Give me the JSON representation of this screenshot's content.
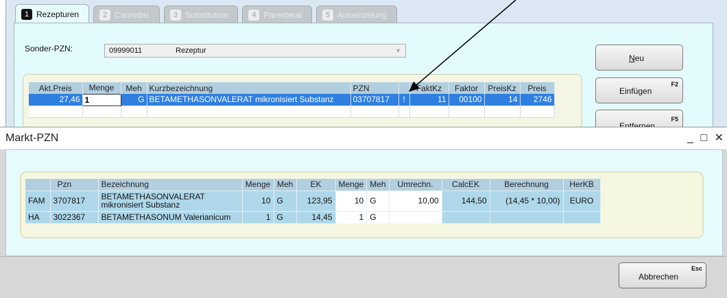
{
  "tabs": [
    {
      "num": "1",
      "label": "Rezepturen"
    },
    {
      "num": "2",
      "label": "Cannabis"
    },
    {
      "num": "3",
      "label": "Substitution"
    },
    {
      "num": "4",
      "label": "Parenteral"
    },
    {
      "num": "5",
      "label": "Auseinzelung"
    }
  ],
  "sonder": {
    "label": "Sonder-PZN:",
    "pzn": "09999011",
    "text": "Rezeptur"
  },
  "upper_grid": {
    "headers": [
      "Akt.Preis",
      "Menge",
      "Meh",
      "Kurzbezeichnung",
      "PZN",
      "",
      "FaktKz",
      "Faktor",
      "PreisKz",
      "Preis"
    ],
    "row": [
      "27,46",
      "1",
      "G",
      "BETAMETHASONVALERAT mikronisiert Substanz",
      "03707817",
      "!",
      "11",
      "00100",
      "14",
      "2746"
    ]
  },
  "buttons": {
    "neu": {
      "underline": "N",
      "rest": "eu"
    },
    "einfuegen": {
      "label": "Einfügen",
      "key": "F2"
    },
    "entfernen": {
      "label": "Entfernen",
      "key": "F5"
    }
  },
  "popup": {
    "title": "Markt-PZN",
    "controls": "_ □ ✕",
    "headers": [
      "",
      "Pzn",
      "Bezeichnung",
      "Menge",
      "Meh",
      "EK",
      "Menge",
      "Meh",
      "Umrechn.",
      "CalcEK",
      "Berechnung",
      "HerKB"
    ],
    "rows": [
      {
        "typ": "FAM",
        "pzn": "3707817",
        "bez": "BETAMETHASONVALERAT mikronisiert Substanz",
        "menge": "10",
        "meh": "G",
        "ek": "123,95",
        "menge2": "10",
        "meh2": "G",
        "umrechn": "10,00",
        "calcek": "144,50",
        "berechnung": "(14,45 * 10,00)",
        "herkb": "EURO"
      },
      {
        "typ": "HA",
        "pzn": "3022367",
        "bez": "BETAMETHASONUM Valerianicum",
        "menge": "1",
        "meh": "G",
        "ek": "14,45",
        "menge2": "1",
        "meh2": "G",
        "umrechn": "",
        "calcek": "",
        "berechnung": "",
        "herkb": ""
      }
    ],
    "cancel": {
      "label": "Abbrechen",
      "key": "Esc"
    }
  },
  "colors": {
    "selected_row": "#2f7fe0",
    "grid_header": "#b2cfe0",
    "grid_cell": "#aed8ea",
    "panel_bg": "#e5fbfd"
  }
}
